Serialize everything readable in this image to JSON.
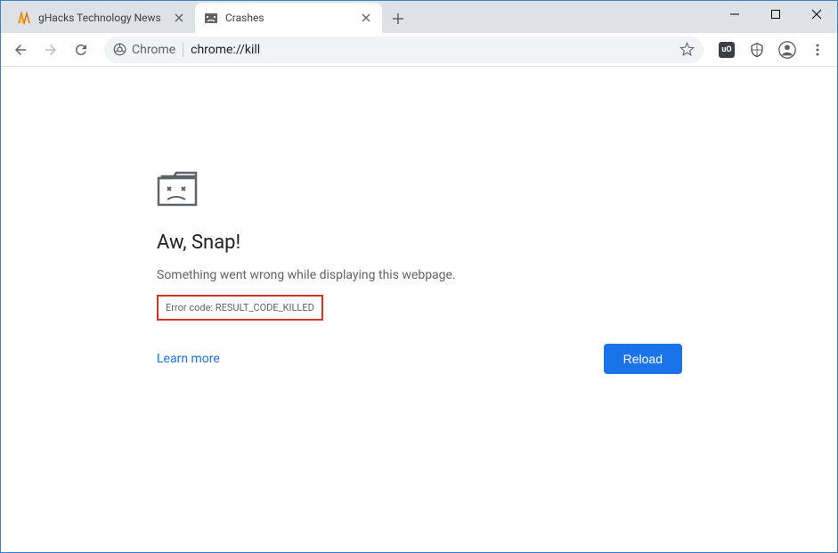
{
  "tabs": [
    {
      "title": "gHacks Technology News",
      "active": false
    },
    {
      "title": "Crashes",
      "active": true
    }
  ],
  "omnibox": {
    "chip": "Chrome",
    "url": "chrome://kill"
  },
  "error": {
    "heading": "Aw, Snap!",
    "message": "Something went wrong while displaying this webpage.",
    "code": "Error code: RESULT_CODE_KILLED",
    "learn": "Learn more",
    "reload": "Reload"
  }
}
